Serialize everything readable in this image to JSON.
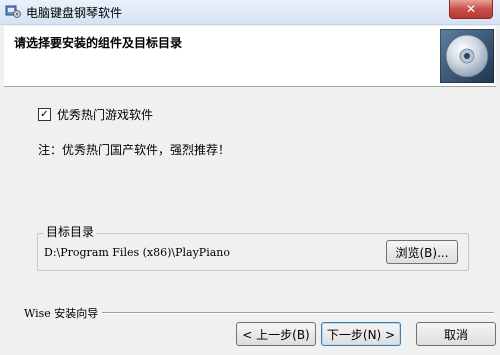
{
  "window": {
    "title": "电脑键盘钢琴软件",
    "close_symbol": "✕"
  },
  "header": {
    "title": "请选择要安装的组件及目标目录",
    "image_icon": "cd-disc-icon"
  },
  "components": {
    "checkbox_checked": true,
    "checkbox_mark": "✓",
    "checkbox_label": "优秀热门游戏软件"
  },
  "note": "注：优秀热门国产软件，强烈推荐！",
  "target": {
    "group_label": "目标目录",
    "path": "D:\\Program Files (x86)\\PlayPiano",
    "browse_label": "浏览(B)..."
  },
  "footer": {
    "wizard_label": "Wise 安装向导",
    "back_label": "< 上一步(B)",
    "next_label": "下一步(N) >",
    "cancel_label": "取消"
  }
}
